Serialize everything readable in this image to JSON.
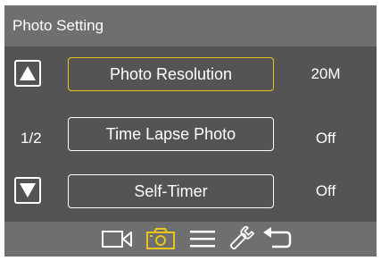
{
  "header": {
    "title": "Photo Setting"
  },
  "pagination": {
    "current": "1/2"
  },
  "menu": {
    "items": [
      {
        "label": "Photo Resolution",
        "value": "20M",
        "selected": true
      },
      {
        "label": "Time Lapse Photo",
        "value": "Off",
        "selected": false
      },
      {
        "label": "Self-Timer",
        "value": "Off",
        "selected": false
      }
    ]
  },
  "toolbar": {
    "icons": [
      "video-camera-icon",
      "photo-camera-icon",
      "menu-icon",
      "wrench-icon",
      "back-icon"
    ],
    "active_icon": "photo-camera-icon"
  },
  "colors": {
    "background": "#545454",
    "bar": "#6f6f6f",
    "accent": "#e8c51d",
    "text": "#ffffff"
  }
}
